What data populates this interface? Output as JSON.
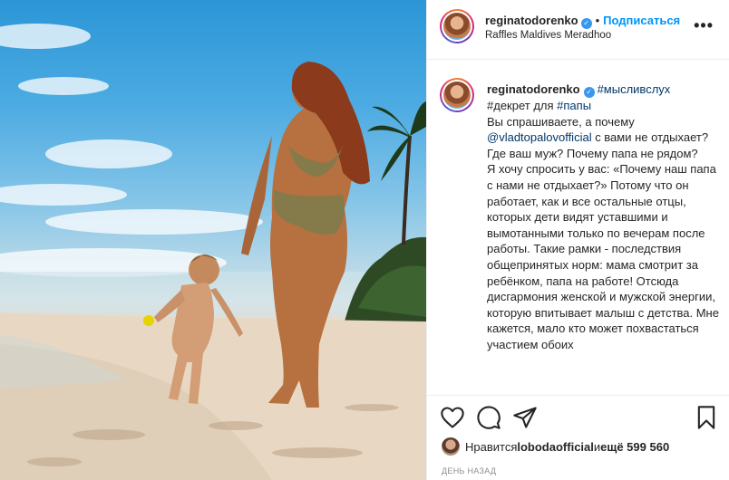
{
  "post": {
    "username": "reginatodorenko",
    "follow_label": "Подписаться",
    "separator": "•",
    "location": "Raffles Maldives Meradhoo",
    "more_label": "•••"
  },
  "caption": {
    "username": "reginatodorenko",
    "tag1": "#мысливслух",
    "line2": "#декрет для ",
    "tag2": "#папы",
    "text1": "Вы спрашиваете, а почему ",
    "mention": "@vladtopalovofficial",
    "text2": " с вами не отдыхает? Где ваш муж? Почему папа не рядом?",
    "text3": "Я хочу спросить у вас: «Почему наш папа с нами не отдыхает?» Потому что он работает, как и все остальные отцы, которых дети видят уставшими и вымотанными только по вечерам после работы. Такие рамки - последствия общепринятых норм: мама смотрит за ребёнком, папа на работе! Отсюда дисгармония женской и мужской энергии, которую впитывает малыш с детства. Мне кажется, мало кто может похвастаться участием обоих"
  },
  "likes": {
    "prefix": "Нравится ",
    "user": "lobodaofficial",
    "middle": " и ",
    "count": "ещё 599 560"
  },
  "timestamp": "ДЕНЬ НАЗАД",
  "icons": {
    "like": "heart-icon",
    "comment": "comment-icon",
    "share": "share-icon",
    "save": "bookmark-icon",
    "verified": "verified-badge-icon"
  },
  "colors": {
    "follow": "#0095f6",
    "hashtag": "#00376b",
    "verified": "#3897f0"
  }
}
